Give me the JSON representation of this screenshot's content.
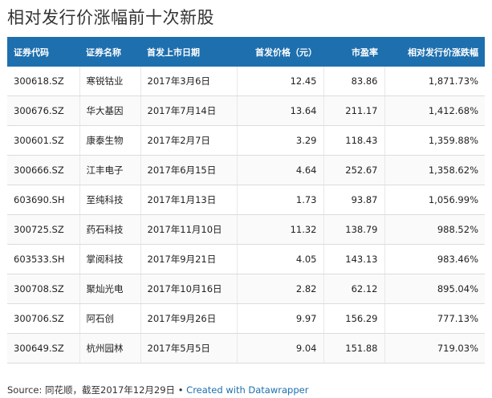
{
  "title": "相对发行价涨幅前十次新股",
  "columns": [
    "证券代码",
    "证券名称",
    "首发上市日期",
    "首发价格（元）",
    "市盈率",
    "相对发行价涨跌幅"
  ],
  "rows": [
    [
      "300618.SZ",
      "寒锐钴业",
      "2017年3月6日",
      "12.45",
      "83.86",
      "1,871.73%"
    ],
    [
      "300676.SZ",
      "华大基因",
      "2017年7月14日",
      "13.64",
      "211.17",
      "1,412.68%"
    ],
    [
      "300601.SZ",
      "康泰生物",
      "2017年2月7日",
      "3.29",
      "118.43",
      "1,359.88%"
    ],
    [
      "300666.SZ",
      "江丰电子",
      "2017年6月15日",
      "4.64",
      "252.67",
      "1,358.62%"
    ],
    [
      "603690.SH",
      "至纯科技",
      "2017年1月13日",
      "1.73",
      "93.87",
      "1,056.99%"
    ],
    [
      "300725.SZ",
      "药石科技",
      "2017年11月10日",
      "11.32",
      "138.79",
      "988.52%"
    ],
    [
      "603533.SH",
      "掌阅科技",
      "2017年9月21日",
      "4.05",
      "143.13",
      "983.46%"
    ],
    [
      "300708.SZ",
      "聚灿光电",
      "2017年10月16日",
      "2.82",
      "62.12",
      "895.04%"
    ],
    [
      "300706.SZ",
      "阿石创",
      "2017年9月26日",
      "9.97",
      "156.29",
      "777.13%"
    ],
    [
      "300649.SZ",
      "杭州园林",
      "2017年5月5日",
      "9.04",
      "151.88",
      "719.03%"
    ]
  ],
  "footer": {
    "source": "Source: 同花顺，截至2017年12月29日",
    "separator": " • ",
    "credit": "Created with Datawrapper"
  },
  "colors": {
    "header_bg": "#1d6fae",
    "header_text": "#ffffff",
    "link": "#1d6fae"
  },
  "chart_data": {
    "type": "table",
    "title": "相对发行价涨幅前十次新股",
    "columns": [
      "证券代码",
      "证券名称",
      "首发上市日期",
      "首发价格（元）",
      "市盈率",
      "相对发行价涨跌幅"
    ],
    "rows": [
      [
        "300618.SZ",
        "寒锐钴业",
        "2017年3月6日",
        12.45,
        83.86,
        "1,871.73%"
      ],
      [
        "300676.SZ",
        "华大基因",
        "2017年7月14日",
        13.64,
        211.17,
        "1,412.68%"
      ],
      [
        "300601.SZ",
        "康泰生物",
        "2017年2月7日",
        3.29,
        118.43,
        "1,359.88%"
      ],
      [
        "300666.SZ",
        "江丰电子",
        "2017年6月15日",
        4.64,
        252.67,
        "1,358.62%"
      ],
      [
        "603690.SH",
        "至纯科技",
        "2017年1月13日",
        1.73,
        93.87,
        "1,056.99%"
      ],
      [
        "300725.SZ",
        "药石科技",
        "2017年11月10日",
        11.32,
        138.79,
        "988.52%"
      ],
      [
        "603533.SH",
        "掌阅科技",
        "2017年9月21日",
        4.05,
        143.13,
        "983.46%"
      ],
      [
        "300708.SZ",
        "聚灿光电",
        "2017年10月16日",
        2.82,
        62.12,
        "895.04%"
      ],
      [
        "300706.SZ",
        "阿石创",
        "2017年9月26日",
        9.97,
        156.29,
        "777.13%"
      ],
      [
        "300649.SZ",
        "杭州园林",
        "2017年5月5日",
        9.04,
        151.88,
        "719.03%"
      ]
    ]
  }
}
